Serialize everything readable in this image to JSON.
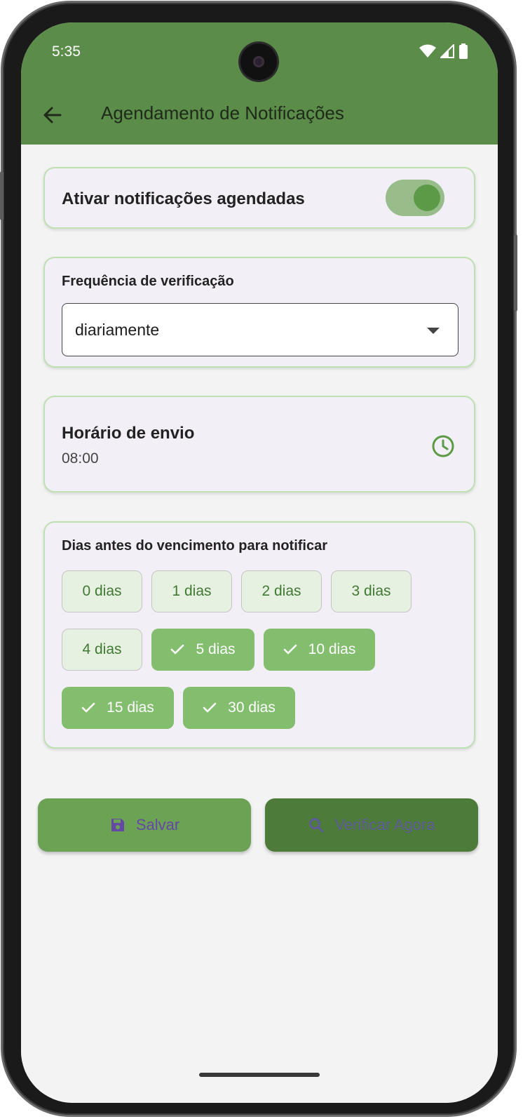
{
  "status_bar": {
    "time": "5:35"
  },
  "appbar": {
    "title": "Agendamento de Notificações"
  },
  "enable_card": {
    "label": "Ativar notificações agendadas",
    "enabled": true
  },
  "frequency_card": {
    "label": "Frequência de verificação",
    "selected": "diariamente"
  },
  "time_card": {
    "label": "Horário de envio",
    "value": "08:00"
  },
  "days_card": {
    "label": "Dias antes do vencimento para notificar",
    "chips": [
      {
        "label": "0 dias",
        "selected": false
      },
      {
        "label": "1 dias",
        "selected": false
      },
      {
        "label": "2 dias",
        "selected": false
      },
      {
        "label": "3 dias",
        "selected": false
      },
      {
        "label": "4 dias",
        "selected": false
      },
      {
        "label": "5 dias",
        "selected": true
      },
      {
        "label": "10 dias",
        "selected": true
      },
      {
        "label": "15 dias",
        "selected": true
      },
      {
        "label": "30 dias",
        "selected": true
      }
    ]
  },
  "actions": {
    "save_label": "Salvar",
    "check_label": "Verificar Agora"
  },
  "colors": {
    "primary": "#5b8c4a",
    "card_border": "#bfe0b2",
    "chip_selected": "#83bd6e",
    "chip_unselected": "#e7f1e1",
    "button_icon": "#6548a5"
  },
  "icons": {
    "back": "arrow-left-icon",
    "clock": "clock-icon",
    "save": "save-icon",
    "search": "search-icon",
    "check": "check-icon",
    "wifi": "wifi-icon",
    "signal": "signal-icon",
    "battery": "battery-icon"
  }
}
